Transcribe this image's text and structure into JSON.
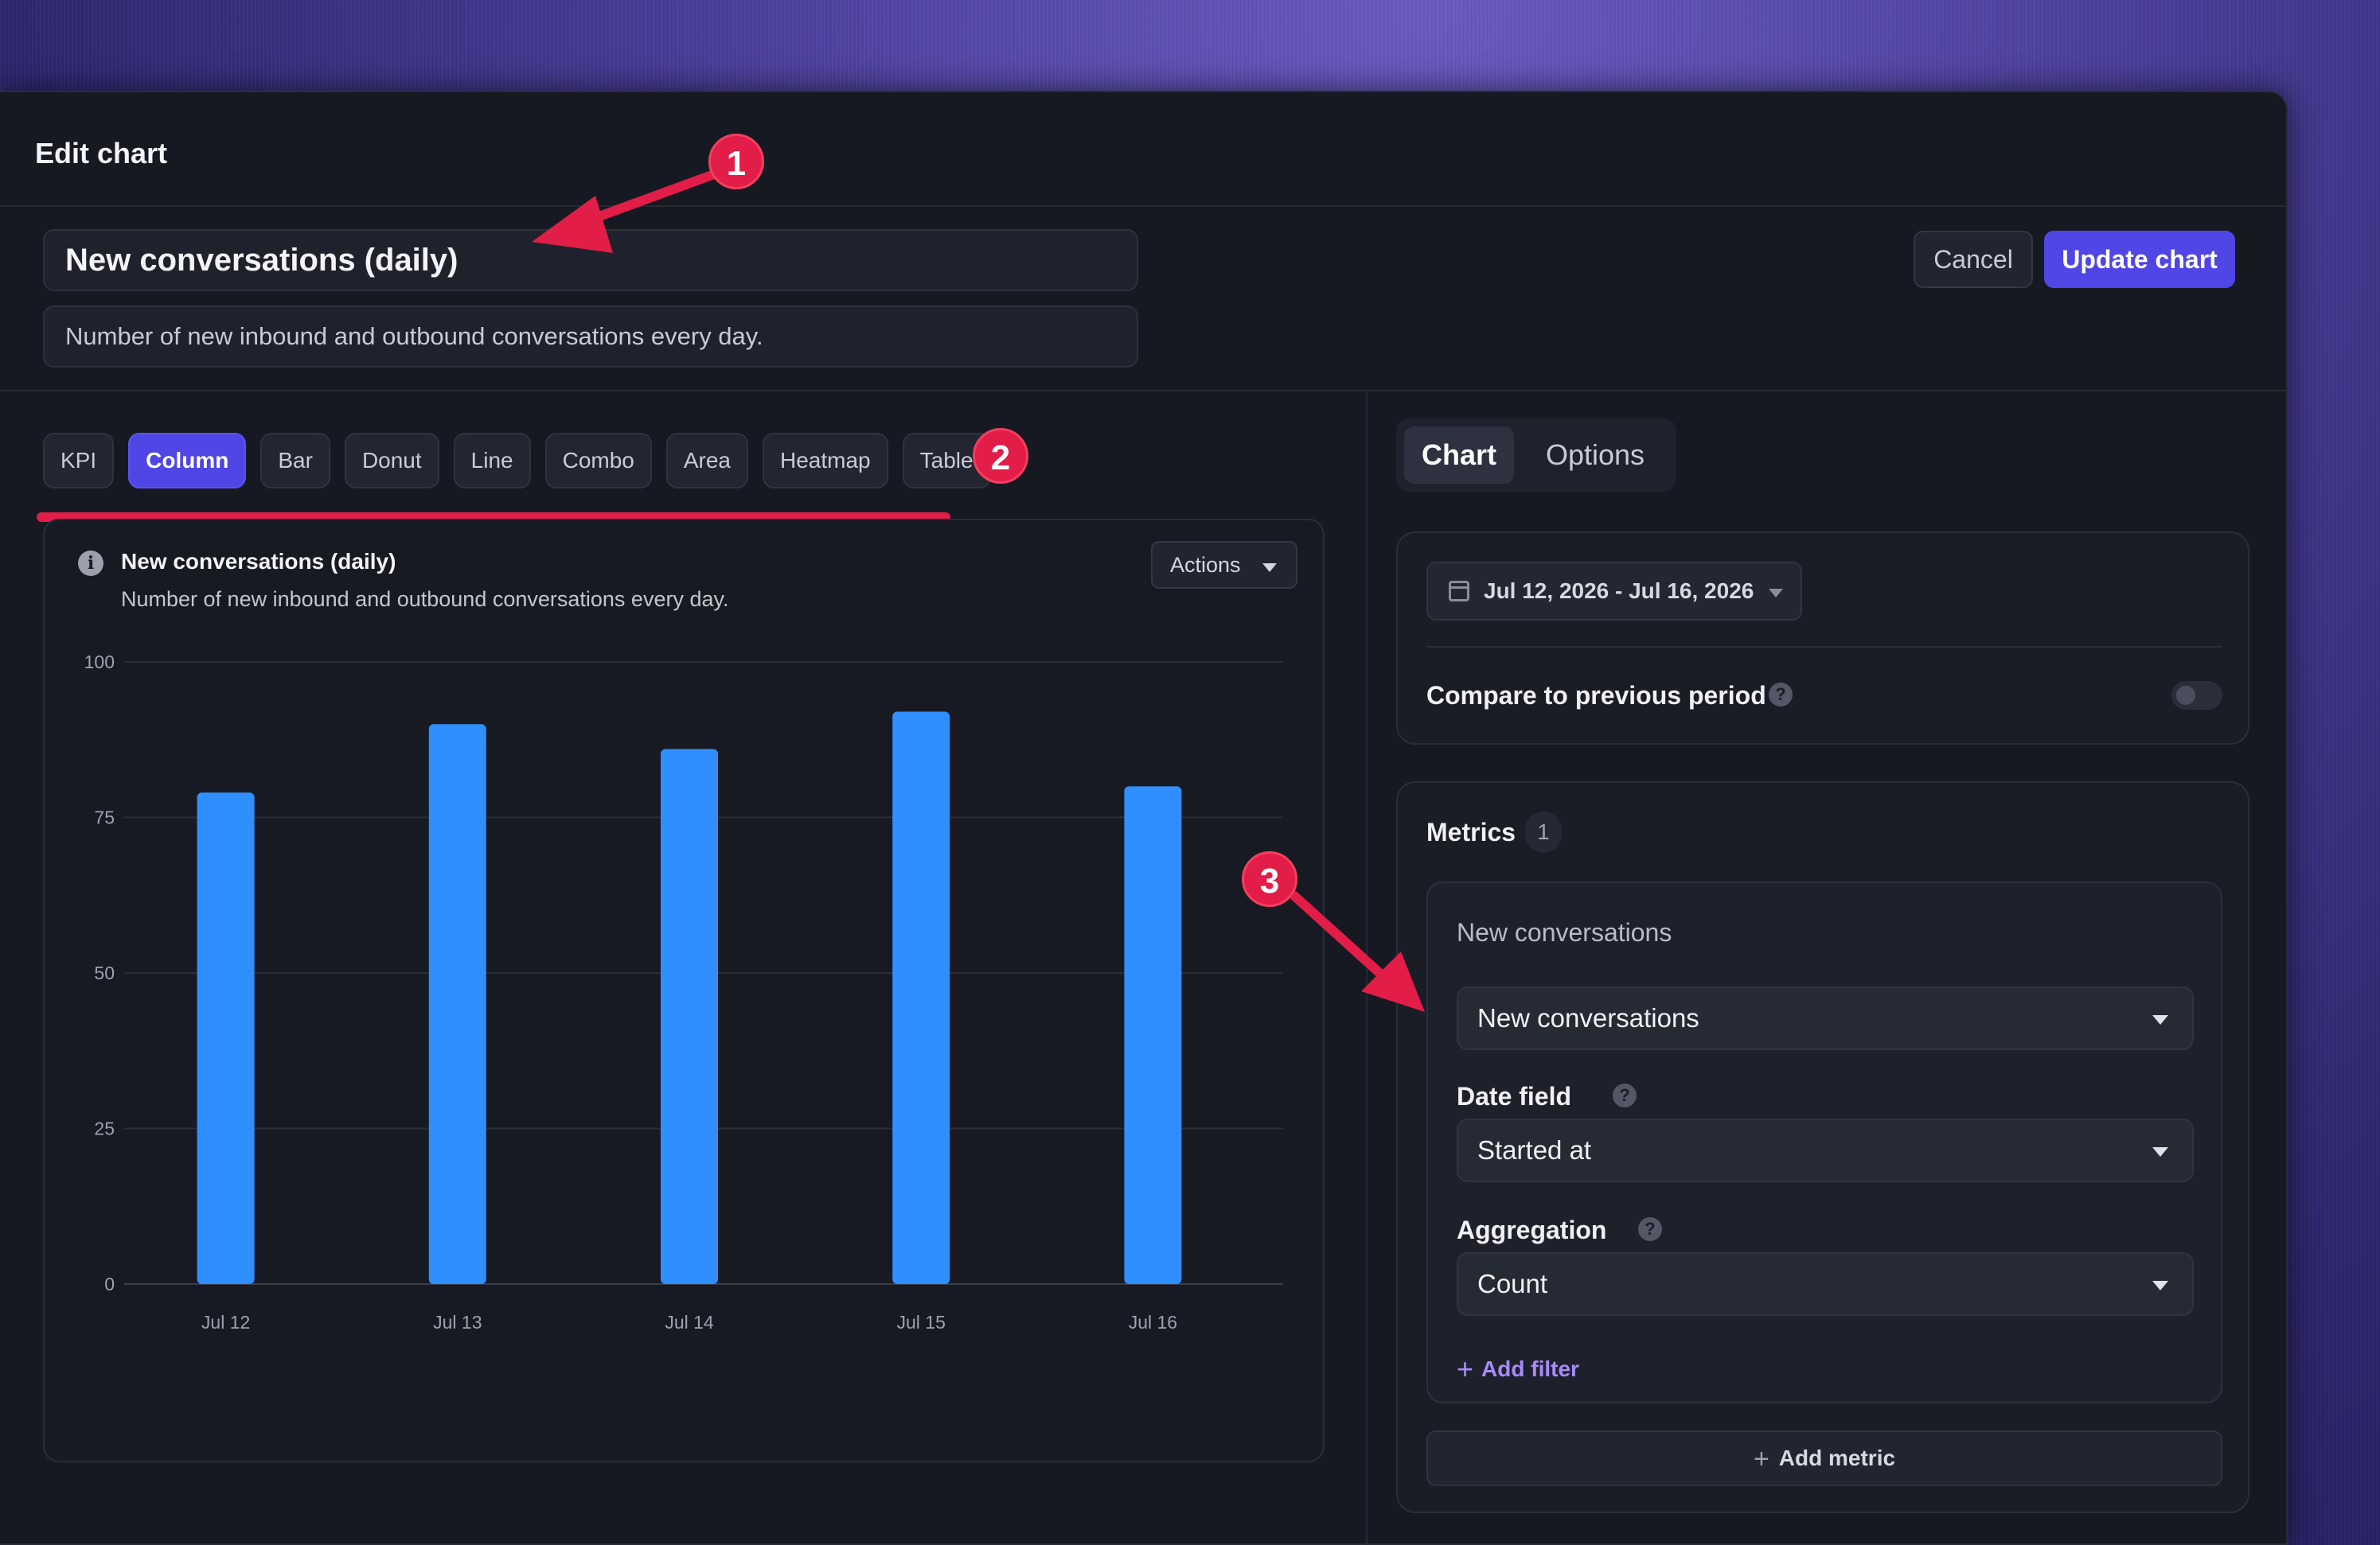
{
  "window": {
    "title": "Edit chart"
  },
  "header": {
    "chart_title": "New conversations (daily)",
    "chart_description": "Number of new inbound and outbound conversations every day.",
    "cancel_label": "Cancel",
    "update_label": "Update chart"
  },
  "chart_types": {
    "items": [
      "KPI",
      "Column",
      "Bar",
      "Donut",
      "Line",
      "Combo",
      "Area",
      "Heatmap",
      "Table"
    ],
    "active": "Column"
  },
  "preview": {
    "title": "New conversations (daily)",
    "subtitle": "Number of new inbound and outbound conversations every day.",
    "actions_label": "Actions"
  },
  "chart_data": {
    "type": "bar",
    "categories": [
      "Jul 12",
      "Jul 13",
      "Jul 14",
      "Jul 15",
      "Jul 16"
    ],
    "values": [
      79,
      90,
      86,
      92,
      80
    ],
    "ylim": [
      0,
      100
    ],
    "yticks": [
      0,
      25,
      50,
      75,
      100
    ],
    "title": "New conversations (daily)",
    "grid": true,
    "bar_color": "#2f8fff"
  },
  "right_tabs": {
    "chart": "Chart",
    "options": "Options",
    "active": "Chart"
  },
  "date_settings": {
    "range": "Jul 12, 2026 - Jul 16, 2026",
    "compare_label": "Compare to previous period",
    "compare_enabled": false
  },
  "metrics": {
    "label": "Metrics",
    "count": "1",
    "metric": {
      "name": "New conversations",
      "selected_metric": "New conversations",
      "date_field_label": "Date field",
      "date_field_value": "Started at",
      "aggregation_label": "Aggregation",
      "aggregation_value": "Count",
      "add_filter_label": "Add filter"
    },
    "add_metric_label": "Add metric"
  },
  "annotations": {
    "one": "1",
    "two": "2",
    "three": "3"
  },
  "colors": {
    "accent": "#4f46e5",
    "annotation": "#e11d48",
    "bar": "#2f8fff",
    "link": "#a78bfa"
  }
}
